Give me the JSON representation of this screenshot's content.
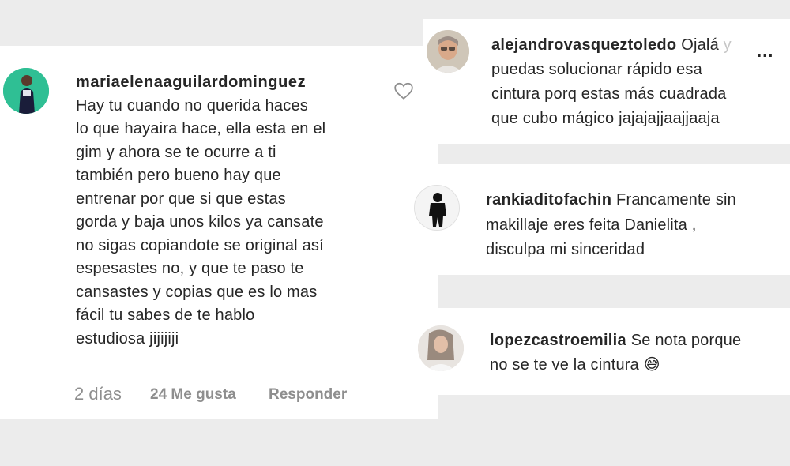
{
  "comments": [
    {
      "username": "mariaelenaaguilardominguez",
      "text_lines": [
        "Hay tu cuando no querida haces",
        "lo que hayaira hace, ella esta en el",
        "gim y ahora se te ocurre a ti",
        "también pero bueno hay que",
        "entrenar por que si que estas",
        "gorda y baja unos kilos ya cansate",
        "no sigas copiandote se original así",
        "espesastes no, y que te paso te",
        "cansastes y copias que es lo mas",
        "fácil tu sabes de te hablo",
        "estudiosa jijijiji"
      ],
      "time": "2 días",
      "likes": "24 Me gusta",
      "reply": "Responder"
    },
    {
      "username": "alejandrovasqueztoledo",
      "first_words": "Ojalá",
      "faded": "y",
      "text_lines": [
        "puedas solucionar rápido esa",
        "cintura porq estas más cuadrada",
        "que cubo mágico jajajajjaajjaaja"
      ],
      "more": "..."
    },
    {
      "username": "rankiaditofachin",
      "first_words": "Francamente sin",
      "text_lines": [
        "makillaje eres feita Danielita ,",
        "disculpa mi sinceridad"
      ]
    },
    {
      "username": "lopezcastroemilia",
      "first_words": "Se nota porque",
      "text_lines": [
        "no se te ve la cintura"
      ],
      "emoji": "😅"
    }
  ],
  "icons": {
    "like": "heart-outline-icon",
    "more": "more-options-icon"
  },
  "colors": {
    "text": "#262626",
    "muted": "#8e8e8e",
    "background": "#ececec"
  }
}
